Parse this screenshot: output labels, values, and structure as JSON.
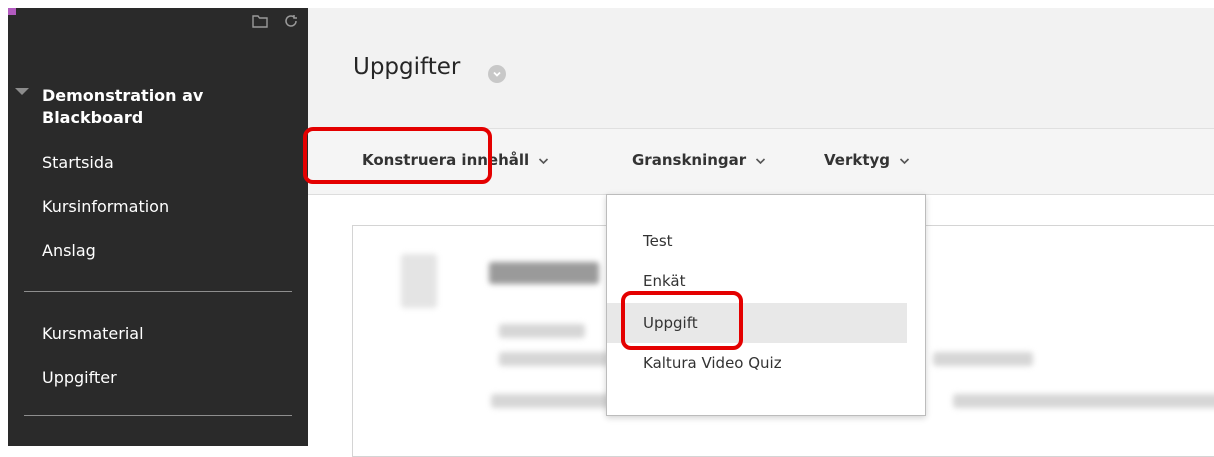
{
  "sidebar": {
    "course_title": "Demonstration av Blackboard",
    "items": [
      {
        "label": "Startsida"
      },
      {
        "label": "Kursinformation"
      },
      {
        "label": "Anslag"
      },
      {
        "label": "Kursmaterial"
      },
      {
        "label": "Uppgifter"
      }
    ],
    "icons": [
      "folder-icon",
      "refresh-icon"
    ]
  },
  "header": {
    "title": "Uppgifter"
  },
  "toolbar": {
    "build_content": "Konstruera innehåll",
    "assessments": "Granskningar",
    "tools": "Verktyg"
  },
  "dropdown": {
    "items": [
      {
        "label": "Test"
      },
      {
        "label": "Enkät"
      },
      {
        "label": "Uppgift",
        "selected": true
      },
      {
        "label": "Kaltura Video Quiz"
      }
    ]
  },
  "colors": {
    "sidebar_bg": "#2a2a2a",
    "highlight": "#e40000",
    "accent_mark": "#b25bbf"
  }
}
